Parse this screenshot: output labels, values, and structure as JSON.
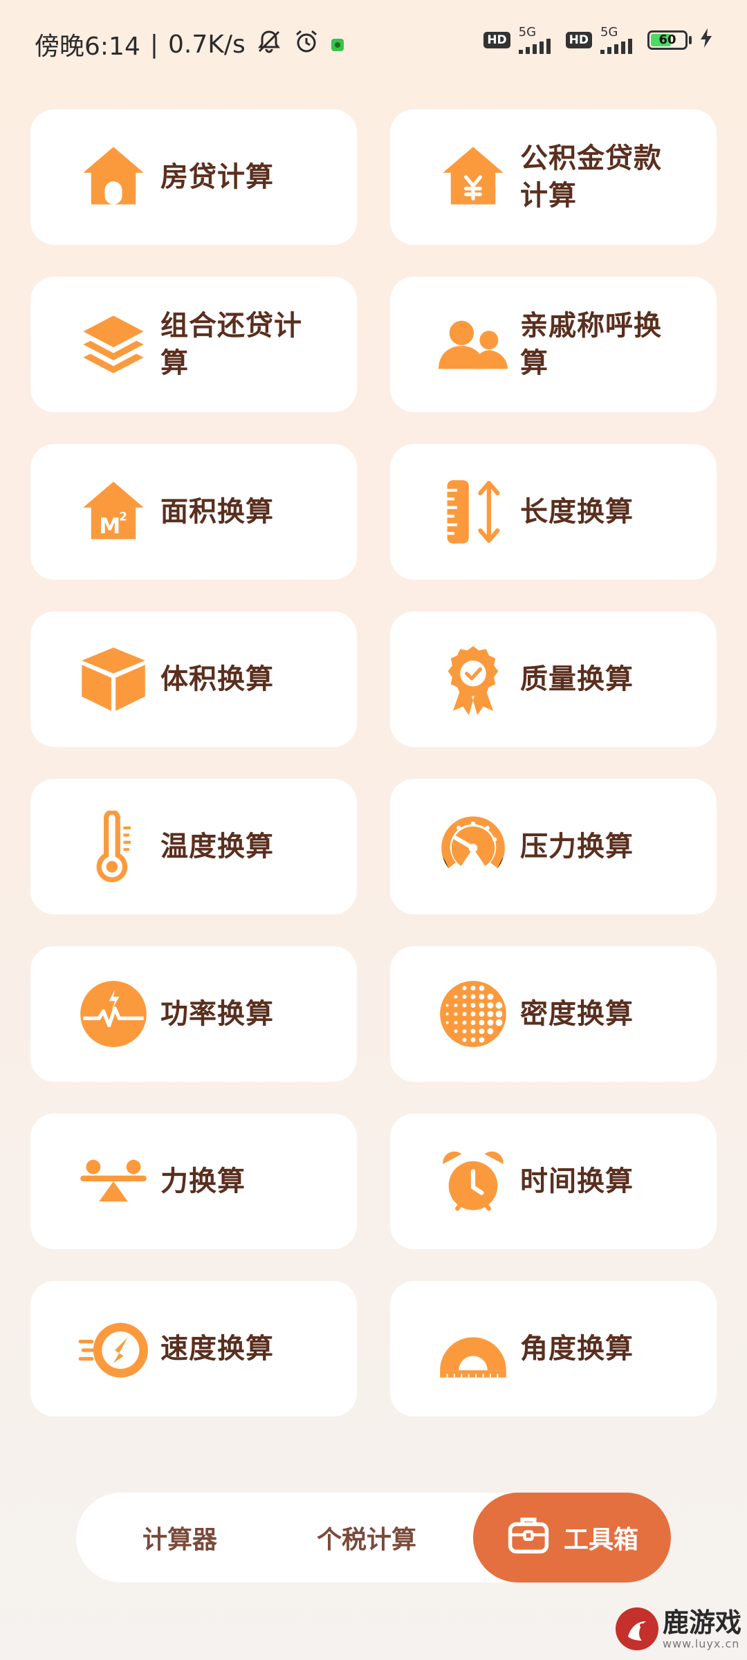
{
  "status_bar": {
    "time": "傍晚6:14",
    "separator": "|",
    "network_speed": "0.7K/s",
    "hd_label": "HD",
    "network_type": "5G",
    "battery_level": "60",
    "battery_fraction": 0.6,
    "accent_green": "#4cd964"
  },
  "tools": [
    {
      "label": "房贷计算",
      "icon": "house-icon"
    },
    {
      "label": "公积金贷款计算",
      "icon": "house-yuan-icon"
    },
    {
      "label": "组合还贷计算",
      "icon": "layers-icon"
    },
    {
      "label": "亲戚称呼换算",
      "icon": "people-icon"
    },
    {
      "label": "面积换算",
      "icon": "house-m2-icon"
    },
    {
      "label": "长度换算",
      "icon": "ruler-arrows-icon"
    },
    {
      "label": "体积换算",
      "icon": "cube-icon"
    },
    {
      "label": "质量换算",
      "icon": "medal-badge-icon"
    },
    {
      "label": "温度换算",
      "icon": "thermometer-icon"
    },
    {
      "label": "压力换算",
      "icon": "gauge-icon"
    },
    {
      "label": "功率换算",
      "icon": "power-wave-icon"
    },
    {
      "label": "密度换算",
      "icon": "dot-grid-circle-icon"
    },
    {
      "label": "力换算",
      "icon": "seesaw-icon"
    },
    {
      "label": "时间换算",
      "icon": "alarm-clock-icon"
    },
    {
      "label": "速度换算",
      "icon": "speed-compass-icon"
    },
    {
      "label": "角度换算",
      "icon": "protractor-icon"
    }
  ],
  "nav": {
    "calculator": "计算器",
    "tax": "个税计算",
    "tools": "工具箱"
  },
  "watermark": {
    "main": "鹿游戏",
    "sub": "www.luyx.cn"
  },
  "colors": {
    "accent_orange": "#fb9a3d",
    "label_brown": "#5a2f1f",
    "active_tab": "#e4703f"
  }
}
